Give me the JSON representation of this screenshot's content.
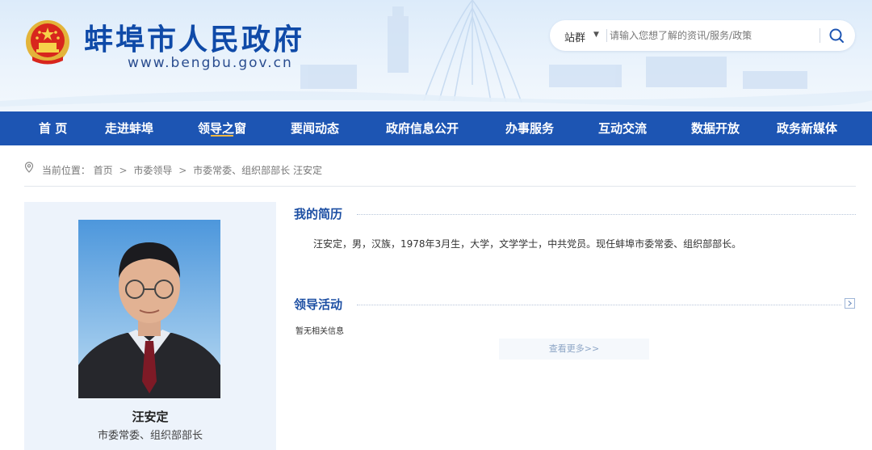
{
  "header": {
    "site_title": "蚌埠市人民政府",
    "site_url": "www.bengbu.gov.cn",
    "search": {
      "scope_label": "站群",
      "placeholder": "请输入您想了解的资讯/服务/政策"
    }
  },
  "nav": {
    "items": [
      {
        "label": "首 页"
      },
      {
        "label": "走进蚌埠"
      },
      {
        "label": "领导之窗"
      },
      {
        "label": "要闻动态"
      },
      {
        "label": "政府信息公开"
      },
      {
        "label": "办事服务"
      },
      {
        "label": "互动交流"
      },
      {
        "label": "数据开放"
      },
      {
        "label": "政务新媒体"
      }
    ],
    "active_label": "领导之窗"
  },
  "breadcrumb": {
    "prefix": "当前位置：",
    "items": [
      "首页",
      "市委领导",
      "市委常委、组织部部长 汪安定"
    ],
    "separator": ">"
  },
  "profile": {
    "name": "汪安定",
    "title": "市委常委、组织部部长"
  },
  "resume": {
    "heading": "我的简历",
    "text": "汪安定，男，汉族，1978年3月生，大学，文学学士，中共党员。现任蚌埠市委常委、组织部部长。"
  },
  "activities": {
    "heading": "领导活动",
    "empty_text": "暂无相关信息",
    "more_label": "查看更多>>"
  },
  "colors": {
    "nav_bg": "#1d55b3",
    "title_blue": "#0f4aa8",
    "section_blue": "#1d4fa3",
    "card_bg": "#edf3fb"
  }
}
